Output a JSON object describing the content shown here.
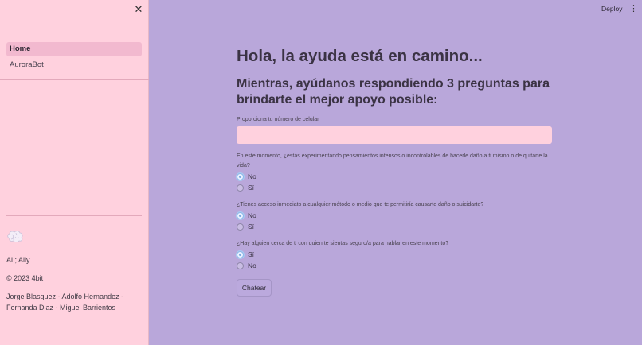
{
  "sidebar": {
    "close_icon": "close-icon",
    "nav": [
      {
        "label": "Home",
        "active": true
      },
      {
        "label": "AuroraBot",
        "active": false
      }
    ],
    "logo_icon": "brain-icon",
    "app_name": "Ai ; Ally",
    "copyright": "© 2023 4bit",
    "authors": "Jorge Blasquez - Adolfo Hernandez - Fernanda Diaz - Miguel Barrientos"
  },
  "header": {
    "deploy_label": "Deploy",
    "menu_icon": "more-vertical-icon"
  },
  "main": {
    "title": "Hola, la ayuda está en camino...",
    "subtitle": "Mientras, ayúdanos respondiendo 3 preguntas para brindarte el mejor apoyo posible:",
    "phone_label": "Proporciona tu número de celular",
    "phone_value": "",
    "questions": [
      {
        "text": "En este momento, ¿estás experimentando pensamientos intensos o incontrolables de hacerle daño a ti mismo o de quitarte la vida?",
        "options": [
          "No",
          "Sí"
        ],
        "selected": "No"
      },
      {
        "text": "¿Tienes acceso inmediato a cualquier método o medio que te permitiría causarte daño o suicidarte?",
        "options": [
          "No",
          "Sí"
        ],
        "selected": "No"
      },
      {
        "text": "¿Hay alguien cerca de ti con quien te sientas seguro/a para hablar en este momento?",
        "options": [
          "Sí",
          "No"
        ],
        "selected": "Sí"
      }
    ],
    "submit_label": "Chatear"
  },
  "colors": {
    "main_bg": "#b9a7da",
    "sidebar_bg": "#ffd1de",
    "input_bg": "#ffd1de",
    "nav_active_bg": "#f2b9cf"
  }
}
